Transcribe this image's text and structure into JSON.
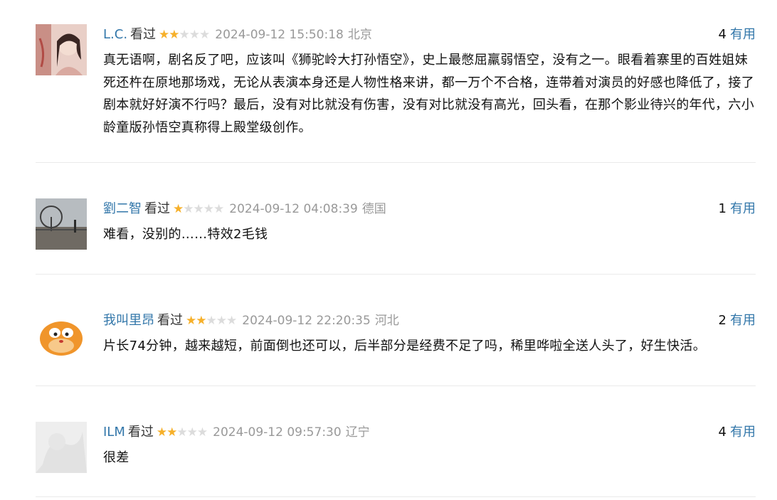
{
  "comments": [
    {
      "username": "L.C.",
      "status": "看过",
      "rating": 2,
      "time": "2024-09-12 15:50:18",
      "location": "北京",
      "votes": "4",
      "useful_label": "有用",
      "text": "真无语啊，剧名反了吧，应该叫《狮驼岭大打孙悟空》，史上最憋屈羸弱悟空，没有之一。眼看着寨里的百姓姐妹死还杵在原地那场戏，无论从表演本身还是人物性格来讲，都一万个不合格，连带着对演员的好感也降低了，接了剧本就好好演不行吗？最后，没有对比就没有伤害，没有对比就没有高光，回头看，在那个影业待兴的年代，六小龄童版孙悟空真称得上殿堂级创作。"
    },
    {
      "username": "劉二智",
      "status": "看过",
      "rating": 1,
      "time": "2024-09-12 04:08:39",
      "location": "德国",
      "votes": "1",
      "useful_label": "有用",
      "text": "难看，没别的……特效2毛钱"
    },
    {
      "username": "我叫里昂",
      "status": "看过",
      "rating": 2,
      "time": "2024-09-12 22:20:35",
      "location": "河北",
      "votes": "2",
      "useful_label": "有用",
      "text": "片长74分钟，越来越短，前面倒也还可以，后半部分是经费不足了吗，稀里哗啦全送人头了，好生快活。"
    },
    {
      "username": "ILM",
      "status": "看过",
      "rating": 2,
      "time": "2024-09-12 09:57:30",
      "location": "辽宁",
      "votes": "4",
      "useful_label": "有用",
      "text": "很差"
    }
  ]
}
